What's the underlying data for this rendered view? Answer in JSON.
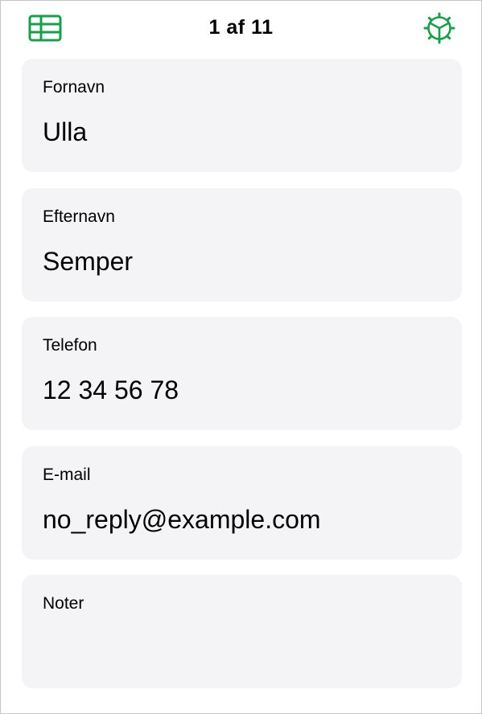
{
  "header": {
    "title": "1 af 11",
    "left_icon": "table-icon",
    "right_icon": "gear-play-icon",
    "accent_color": "#1a9e4b"
  },
  "fields": [
    {
      "label": "Fornavn",
      "value": "Ulla"
    },
    {
      "label": "Efternavn",
      "value": "Semper"
    },
    {
      "label": "Telefon",
      "value": "12 34 56 78"
    },
    {
      "label": "E-mail",
      "value": "no_reply@example.com"
    },
    {
      "label": "Noter",
      "value": ""
    }
  ]
}
